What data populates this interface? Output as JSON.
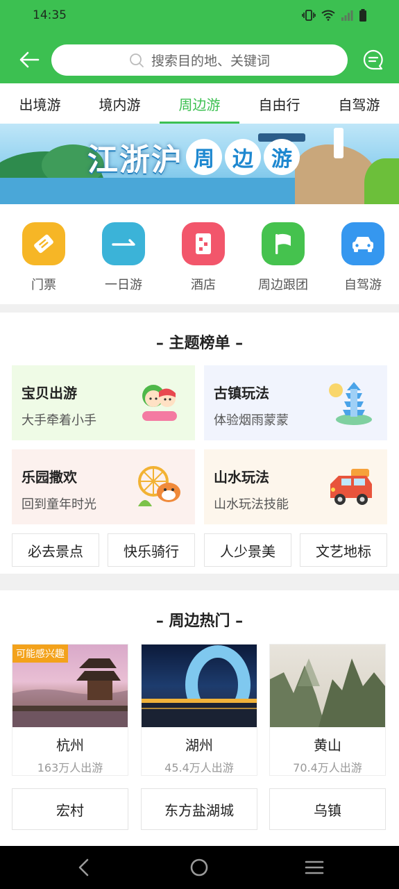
{
  "status_bar": {
    "time": "14:35"
  },
  "search": {
    "placeholder": "搜索目的地、关键词"
  },
  "tabs": [
    {
      "label": "出境游",
      "active": false
    },
    {
      "label": "境内游",
      "active": false
    },
    {
      "label": "周边游",
      "active": true
    },
    {
      "label": "自由行",
      "active": false
    },
    {
      "label": "自驾游",
      "active": false
    }
  ],
  "banner": {
    "title_main": "江浙沪",
    "title_chars": [
      "周",
      "边",
      "游"
    ]
  },
  "quick_entries": [
    {
      "label": "门票",
      "icon": "ticket-icon",
      "color": "#f6b626"
    },
    {
      "label": "一日游",
      "icon": "one-day-icon",
      "color": "#3bb3d8"
    },
    {
      "label": "酒店",
      "icon": "hotel-icon",
      "color": "#f2566b"
    },
    {
      "label": "周边跟团",
      "icon": "flag-icon",
      "color": "#45c24e"
    },
    {
      "label": "自驾游",
      "icon": "car-icon",
      "color": "#3597ef"
    }
  ],
  "theme": {
    "title": "主题榜单",
    "cards": [
      {
        "title": "宝贝出游",
        "subtitle": "大手牵着小手",
        "icon": "kids-icon",
        "bg": "#effbe6"
      },
      {
        "title": "古镇玩法",
        "subtitle": "体验烟雨蒙蒙",
        "icon": "pagoda-icon",
        "bg": "#f1f4fd"
      },
      {
        "title": "乐园撒欢",
        "subtitle": "回到童年时光",
        "icon": "ferris-wheel-icon",
        "bg": "#fcf1ee"
      },
      {
        "title": "山水玩法",
        "subtitle": "山水玩法技能",
        "icon": "camper-car-icon",
        "bg": "#fdf6ec"
      }
    ],
    "chips": [
      "必去景点",
      "快乐骑行",
      "人少景美",
      "文艺地标"
    ]
  },
  "hot": {
    "title": "周边热门",
    "tag": "可能感兴趣",
    "destinations": [
      {
        "name": "杭州",
        "sub": "163万人出游"
      },
      {
        "name": "湖州",
        "sub": "45.4万人出游"
      },
      {
        "name": "黄山",
        "sub": "70.4万人出游"
      }
    ],
    "more": [
      "宏村",
      "东方盐湖城",
      "乌镇"
    ]
  },
  "colors": {
    "brand_green": "#3cc051",
    "tag_orange": "#f3a21b"
  }
}
